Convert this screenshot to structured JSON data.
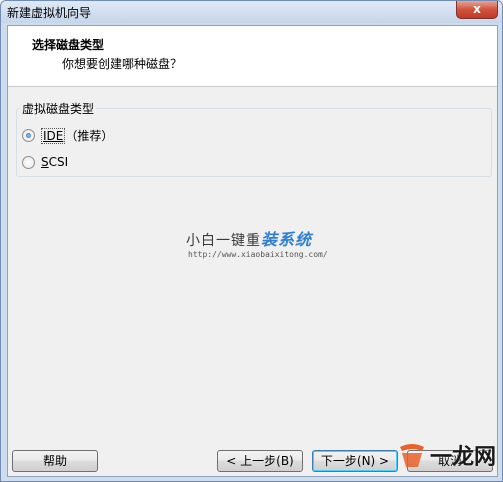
{
  "window": {
    "title": "新建虚拟机向导",
    "close_label": "x"
  },
  "header": {
    "title": "选择磁盘类型",
    "subtitle": "你想要创建哪种磁盘？"
  },
  "group": {
    "legend": "虚拟磁盘类型",
    "options": [
      {
        "label_main": "IDE",
        "label_extra": "（推荐）",
        "checked": true
      },
      {
        "label_first": "S",
        "label_rest": "CSI",
        "checked": false
      }
    ]
  },
  "watermark": {
    "part1": "小白一键重",
    "part2": "装系统",
    "url": "http://www.xiaobaixitong.com/"
  },
  "buttons": {
    "help": "帮助",
    "back": "< 上一步(B)",
    "next": "下一步(N) >",
    "cancel": "取消"
  },
  "corner_watermark": {
    "text": "一龙网"
  },
  "colors": {
    "header_bg": "#ffffff",
    "body_bg": "#f0f0f0",
    "title_bar": "#c6d6ea",
    "close_red": "#c03a25",
    "watermark_blue": "#2f7fd1",
    "corner_logo_orange": "#e8622a"
  }
}
